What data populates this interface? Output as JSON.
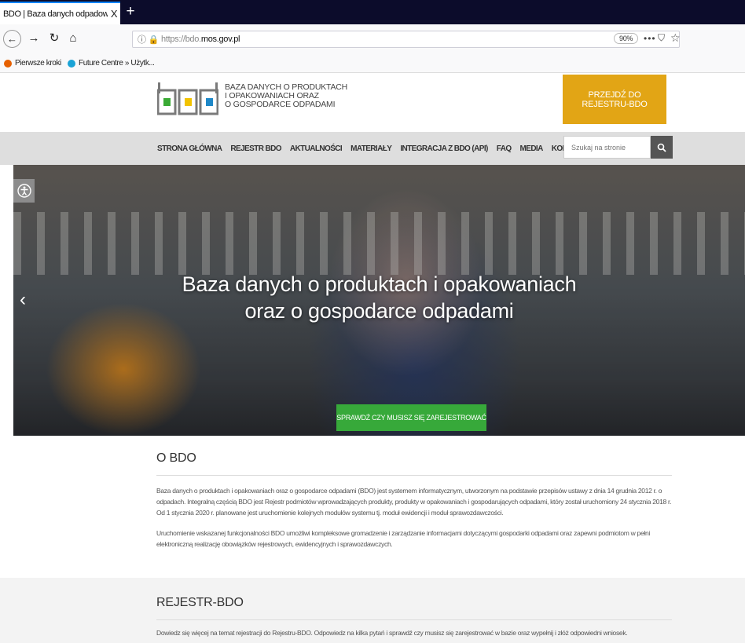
{
  "browser": {
    "tab_title": "BDO | Baza danych odpadowych",
    "tab_close": "X",
    "new_tab": "+",
    "url_prefix": "https://bdo.",
    "url_host": "mos.gov.pl",
    "zoom": "90%",
    "bookmarks": [
      {
        "label": "Pierwsze kroki",
        "color": "#e66000"
      },
      {
        "label": "Future Centre » Użytk...",
        "color": "#1aa3d6"
      }
    ]
  },
  "header": {
    "logo_lines": [
      "BAZA DANYCH O PRODUKTACH",
      "I OPAKOWANIACH ORAZ",
      "O GOSPODARCE ODPADAMI"
    ],
    "cta_lines": [
      "PRZEJDŹ DO",
      "REJESTRU-BDO"
    ],
    "logo_colors": {
      "green": "#3aaa35",
      "yellow": "#f2c300",
      "blue": "#1e88c8",
      "frame": "#7a7a7a"
    }
  },
  "nav": {
    "items": [
      "STRONA GŁÓWNA",
      "REJESTR BDO",
      "AKTUALNOŚCI",
      "MATERIAŁY",
      "INTEGRACJA Z BDO (API)",
      "FAQ",
      "MEDIA",
      "KONTAKT"
    ],
    "search_placeholder": "Szukaj na stronie"
  },
  "hero": {
    "title_line1": "Baza danych o produktach i opakowaniach",
    "title_line2": "oraz o gospodarce odpadami",
    "button": "SPRAWDŹ CZY MUSISZ SIĘ ZAREJESTROWAĆ",
    "prev": "‹"
  },
  "o_bdo": {
    "title": "O BDO",
    "p1": "Baza danych o produktach i opakowaniach oraz o gospodarce odpadami (BDO) jest systemem informatycznym, utworzonym na podstawie przepisów ustawy z dnia 14 grudnia 2012 r. o odpadach. Integralną częścią BDO jest Rejestr podmiotów wprowadzających produkty, produkty w opakowaniach i gospodarujących odpadami, który został uruchomiony 24 stycznia 2018 r. Od 1 stycznia 2020 r. planowane jest uruchomienie kolejnych modułów systemu tj. moduł ewidencji i moduł sprawozdawczości.",
    "p2": "Uruchomienie wskazanej funkcjonalności BDO umożliwi kompleksowe gromadzenie i zarządzanie informacjami dotyczącymi gospodarki odpadami oraz zapewni podmiotom w pełni elektroniczną realizację obowiązków rejestrowych, ewidencyjnych i sprawozdawczych."
  },
  "rejestr": {
    "title": "REJESTR-BDO",
    "p1": "Dowiedz się więcej na temat rejestracji do Rejestru-BDO. Odpowiedz na kilka pytań i sprawdź czy musisz się zarejestrować w bazie oraz wypełnij i złóż odpowiedni wniosek."
  }
}
